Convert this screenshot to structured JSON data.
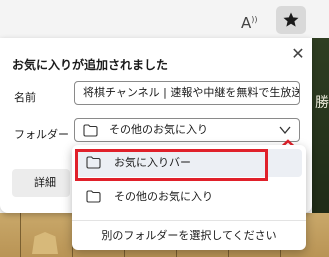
{
  "toolbar": {
    "read_aloud_icon": "read-aloud-icon",
    "favorite_icon": "star-filled-icon"
  },
  "dialog": {
    "title": "お気に入りが追加されました",
    "close_icon": "close-icon",
    "name_label": "名前",
    "name_value": "将棋チャンネル | 速報や中継を無料で生放送",
    "folder_label": "フォルダー",
    "folder_value": "その他のお気に入り",
    "more_button": "詳細"
  },
  "dropdown": {
    "items": [
      {
        "label": "お気に入りバー",
        "icon": "folder-icon"
      },
      {
        "label": "その他のお気に入り",
        "icon": "folder-icon"
      }
    ],
    "choose_other": "別のフォルダーを選択してください"
  },
  "background": {
    "board_kanji": "勝"
  },
  "colors": {
    "annotation": "#e0202a",
    "toolbar_bg": "#f4f4f4",
    "selected_item_bg": "#eceff4"
  }
}
